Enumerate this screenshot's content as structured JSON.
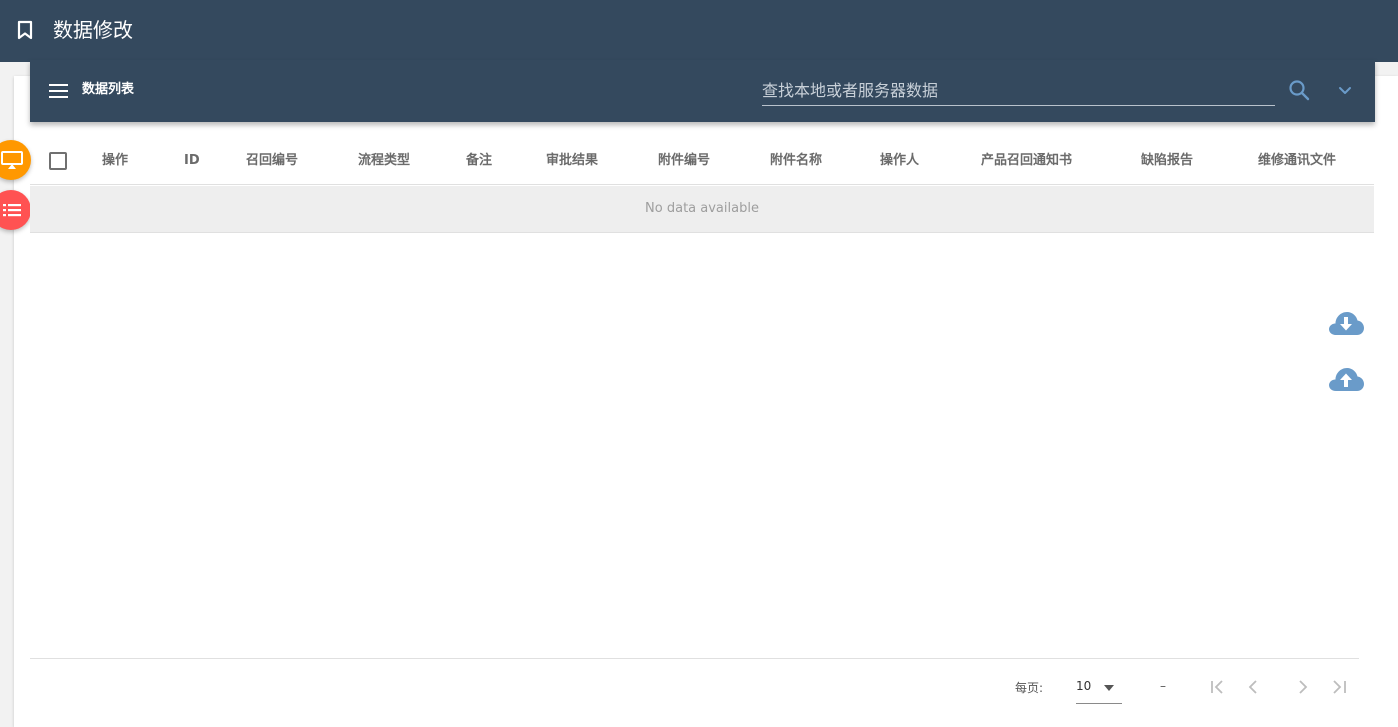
{
  "app": {
    "title": "数据修改"
  },
  "toolbar": {
    "title": "数据列表",
    "search_placeholder": "查找本地或者服务器数据"
  },
  "table": {
    "headers": [
      "操作",
      "ID",
      "召回编号",
      "流程类型",
      "备注",
      "审批结果",
      "附件编号",
      "附件名称",
      "操作人",
      "产品召回通知书",
      "缺陷报告",
      "维修通讯文件"
    ],
    "empty_text": "No data available"
  },
  "footer": {
    "per_page_label": "每页:",
    "per_page_value": "10",
    "range_text": "–"
  },
  "colors": {
    "header_bg": "#34495e",
    "fab_orange": "#ff9800",
    "fab_red": "#ff5252",
    "cloud_blue": "#6a9bc9",
    "search_accent": "#6a9bc9"
  },
  "icons": [
    "bookmark-icon",
    "menu-icon",
    "search-icon",
    "chevron-down-icon",
    "desktop-icon",
    "list-icon",
    "cloud-download-icon",
    "cloud-upload-icon",
    "first-page-icon",
    "prev-page-icon",
    "next-page-icon",
    "last-page-icon"
  ]
}
